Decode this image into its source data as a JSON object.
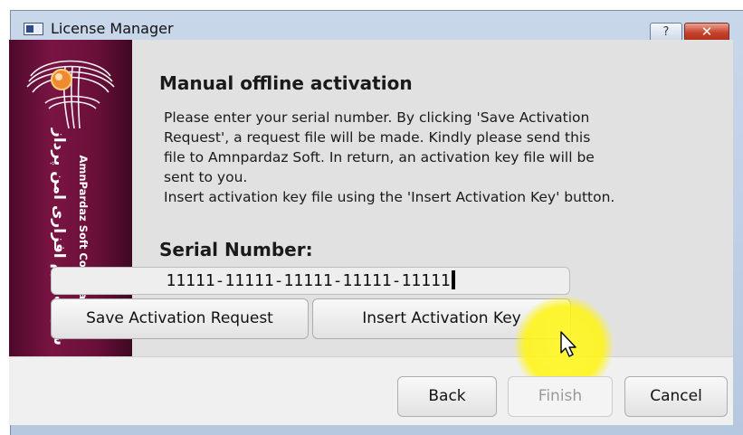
{
  "window": {
    "title": "License Manager",
    "help_label": "?",
    "close_label": "✕"
  },
  "banner": {
    "persian_text": "شرکت نرم افزاری امن پرداز",
    "english_text": "AmnPardaz Soft Corporation"
  },
  "page": {
    "heading": "Manual offline activation",
    "description_lines": [
      "Please enter your serial number. By clicking 'Save Activation",
      "Request', a request file will be made. Kindly please send this",
      "file to Amnpardaz Soft. In return, an activation key file will be",
      "sent to you.",
      "Insert activation key file using the 'Insert Activation Key' button."
    ],
    "serial_label": "Serial Number:",
    "serial_value": "11111-11111-11111-11111-11111",
    "save_request_label": "Save Activation Request",
    "insert_key_label": "Insert Activation Key"
  },
  "footer": {
    "back_label": "Back",
    "finish_label": "Finish",
    "cancel_label": "Cancel"
  },
  "icons": [
    "app-icon",
    "amnpardaz-logo",
    "mouse-cursor-icon"
  ],
  "colors": {
    "banner": "#6a1039",
    "panel": "#e1e1e1",
    "close": "#c4412b",
    "highlight": "#fff528"
  }
}
